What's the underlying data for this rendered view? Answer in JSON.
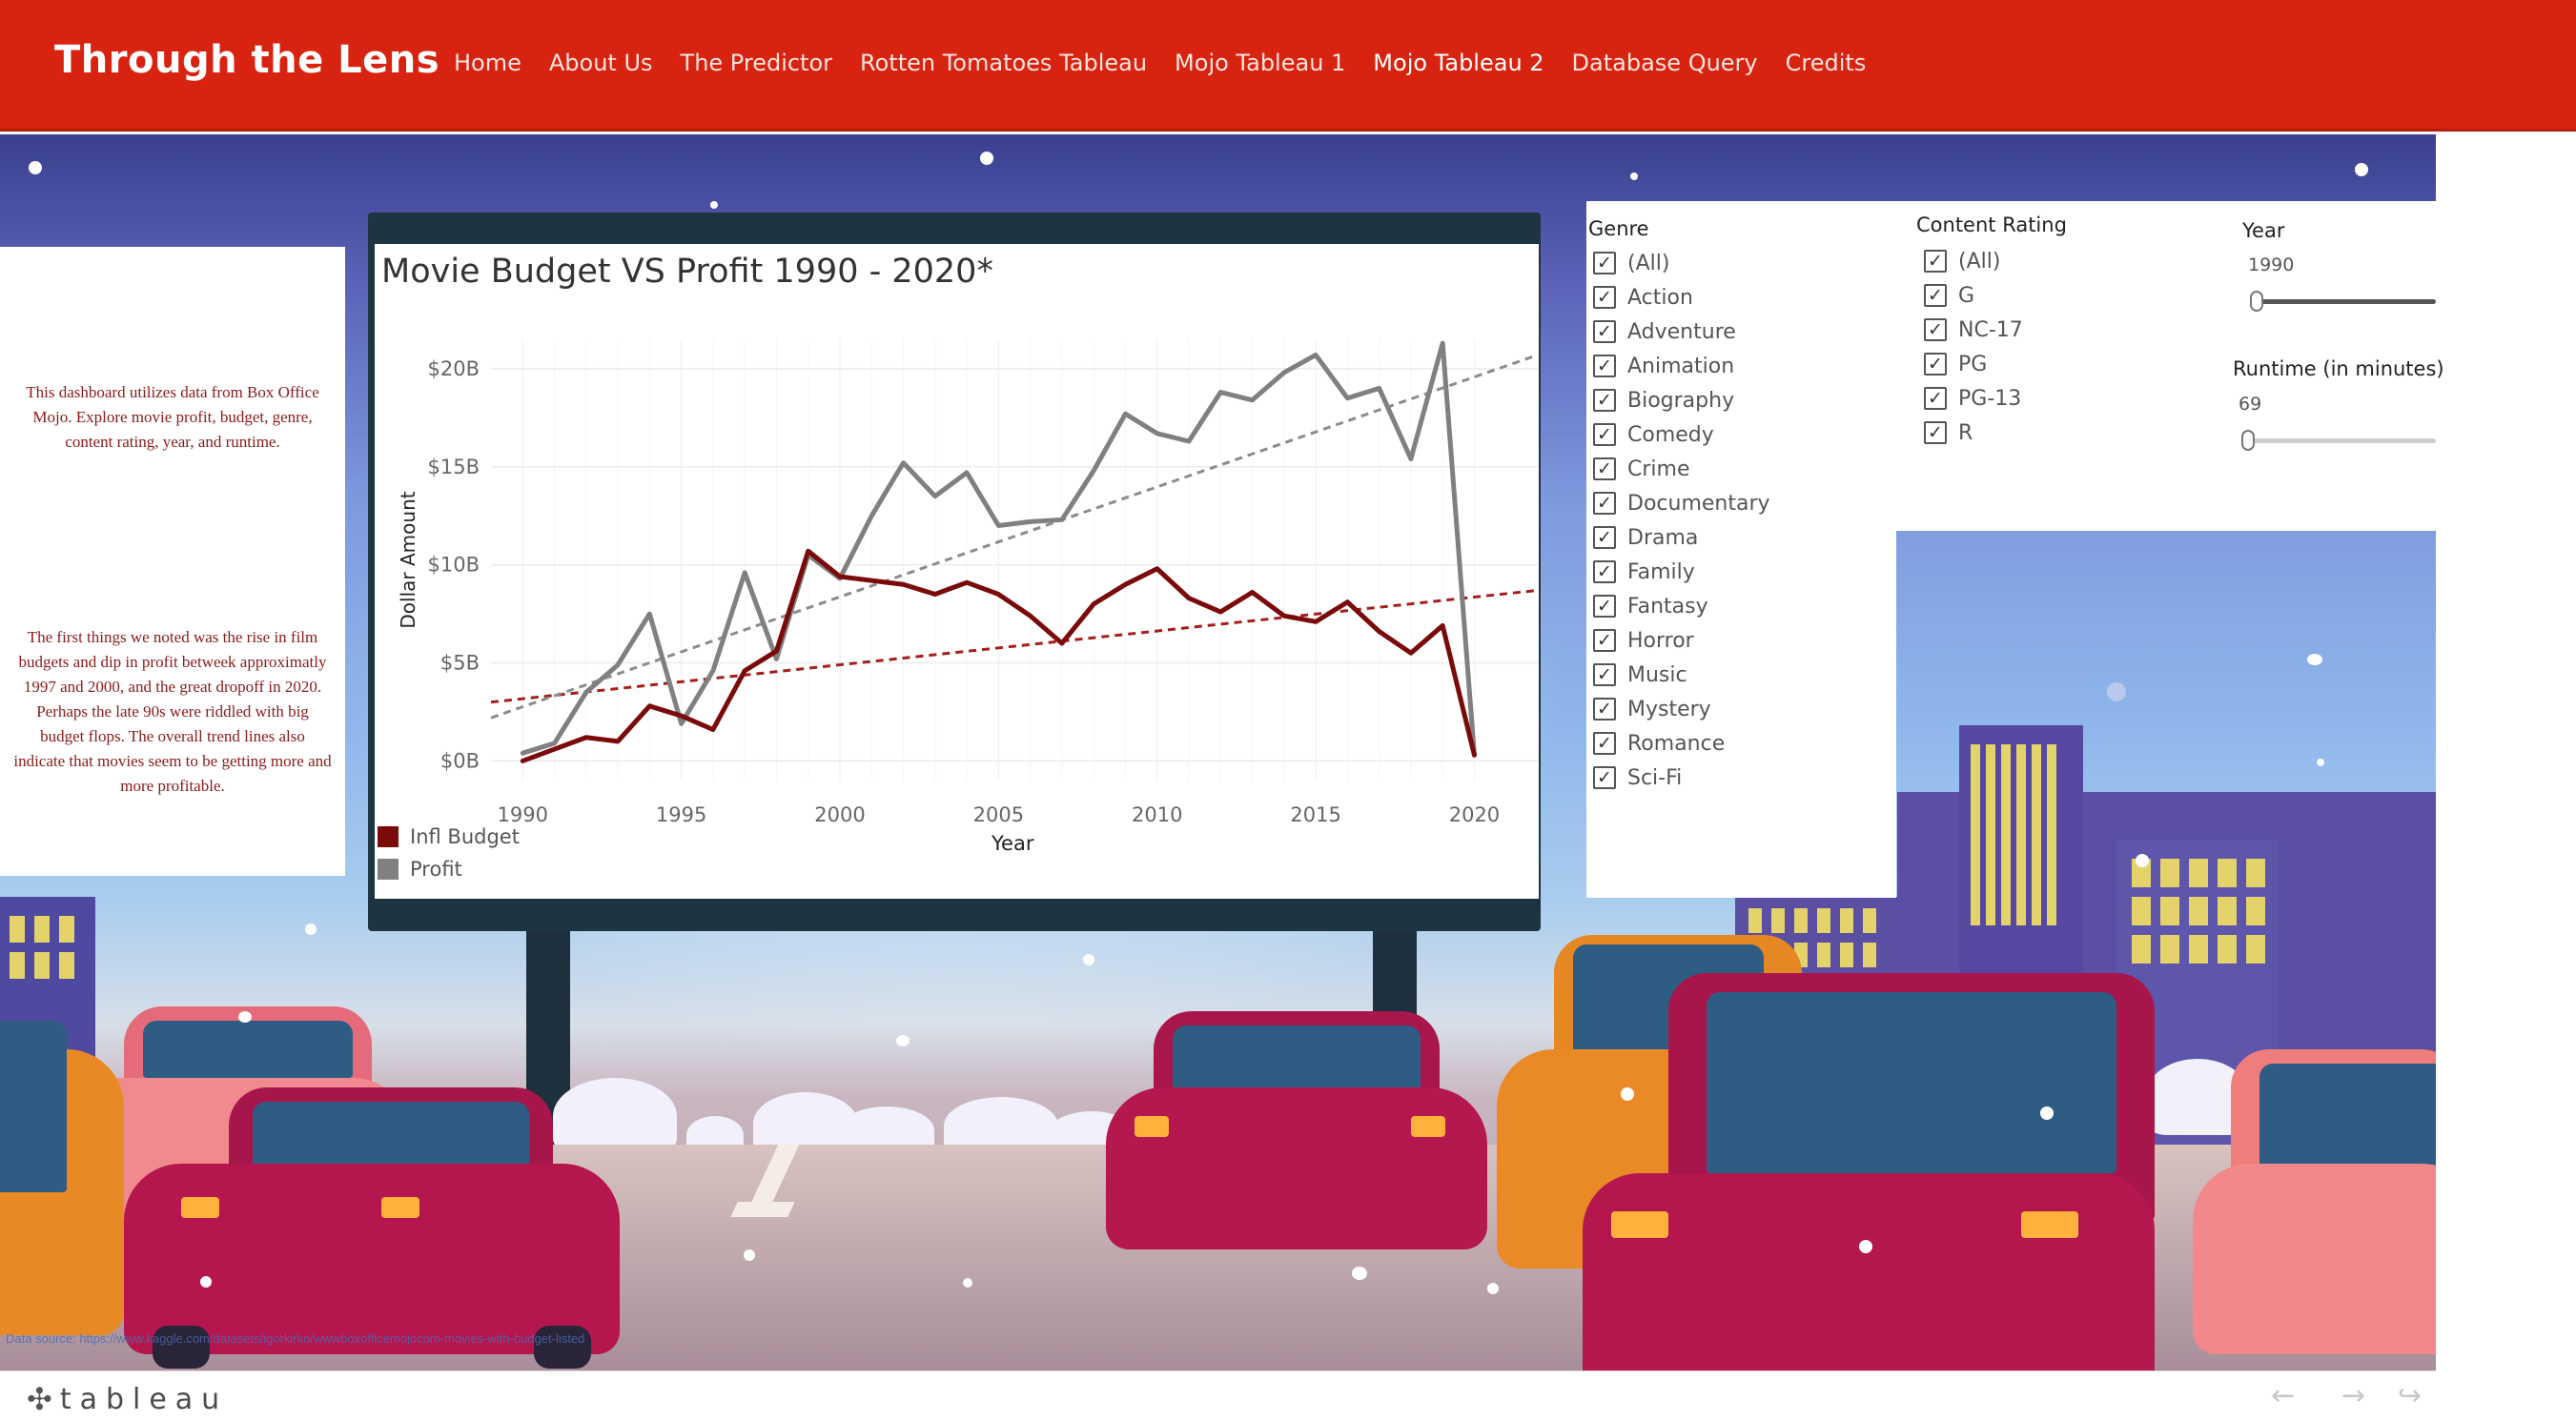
{
  "navbar": {
    "brand": "Through the Lens",
    "links": [
      {
        "label": "Home",
        "active": false
      },
      {
        "label": "About Us",
        "active": false
      },
      {
        "label": "The Predictor",
        "active": false
      },
      {
        "label": "Rotten Tomatoes Tableau",
        "active": false
      },
      {
        "label": "Mojo Tableau 1",
        "active": false
      },
      {
        "label": "Mojo Tableau 2",
        "active": true
      },
      {
        "label": "Database Query",
        "active": false
      },
      {
        "label": "Credits",
        "active": false
      }
    ],
    "bg_color": "#d7230f"
  },
  "description": {
    "paragraph1": "This dashboard utilizes data from Box Office Mojo. Explore movie profit, budget, genre, content rating, year, and runtime.",
    "paragraph2": "The first things we noted was the rise in film budgets and dip in profit betweek approximatly 1997 and 2000, and the great dropoff in 2020. Perhaps the late 90s were riddled with big budget flops. The overall trend lines also indicate that movies seem to be getting more and more profitable."
  },
  "chart_data": {
    "type": "line",
    "title": "Movie Budget VS Profit 1990 - 2020*",
    "xlabel": "Year",
    "ylabel": "Dollar Amount",
    "x": [
      1990,
      1991,
      1992,
      1993,
      1994,
      1995,
      1996,
      1997,
      1998,
      1999,
      2000,
      2001,
      2002,
      2003,
      2004,
      2005,
      2006,
      2007,
      2008,
      2009,
      2010,
      2011,
      2012,
      2013,
      2014,
      2015,
      2016,
      2017,
      2018,
      2019,
      2020
    ],
    "xlim": [
      1989,
      2022
    ],
    "ylim": [
      -1,
      21.5
    ],
    "x_ticks": [
      "1990",
      "1995",
      "2000",
      "2005",
      "2010",
      "2015",
      "2020"
    ],
    "y_ticks": [
      {
        "value": 0,
        "label": "$0B"
      },
      {
        "value": 5,
        "label": "$5B"
      },
      {
        "value": 10,
        "label": "$10B"
      },
      {
        "value": 15,
        "label": "$15B"
      },
      {
        "value": 20,
        "label": "$20B"
      }
    ],
    "series": [
      {
        "name": "Infl Budget",
        "color": "#7b0a0a",
        "values": [
          0.0,
          0.6,
          1.2,
          1.0,
          2.8,
          2.3,
          1.6,
          4.6,
          5.6,
          10.7,
          9.4,
          9.2,
          9.0,
          8.5,
          9.1,
          8.5,
          7.4,
          6.0,
          8.0,
          9.0,
          9.8,
          8.3,
          7.6,
          8.6,
          7.4,
          7.1,
          8.1,
          6.6,
          5.5,
          6.9,
          0.3
        ]
      },
      {
        "name": "Profit",
        "color": "#808080",
        "values": [
          0.4,
          0.9,
          3.5,
          4.9,
          7.5,
          1.9,
          4.6,
          9.6,
          5.2,
          10.5,
          9.3,
          12.5,
          15.2,
          13.5,
          14.7,
          12.0,
          12.2,
          12.3,
          14.8,
          17.7,
          16.7,
          16.3,
          18.8,
          18.4,
          19.8,
          20.7,
          18.5,
          19.0,
          15.4,
          21.3,
          0.3
        ]
      }
    ],
    "trend_lines": [
      {
        "series": "Infl Budget",
        "color": "#a61d1d",
        "from": [
          1989,
          3.0
        ],
        "to": [
          2022,
          8.7
        ]
      },
      {
        "series": "Profit",
        "color": "#8c8c8c",
        "from": [
          1989,
          2.2
        ],
        "to": [
          2022,
          20.7
        ]
      }
    ],
    "legend_position": "bottom-left",
    "grid": true
  },
  "filters": {
    "genre": {
      "heading": "Genre",
      "options": [
        "(All)",
        "Action",
        "Adventure",
        "Animation",
        "Biography",
        "Comedy",
        "Crime",
        "Documentary",
        "Drama",
        "Family",
        "Fantasy",
        "Horror",
        "Music",
        "Mystery",
        "Romance",
        "Sci-Fi"
      ],
      "all_checked": true
    },
    "content_rating": {
      "heading": "Content Rating",
      "options": [
        "(All)",
        "G",
        "NC-17",
        "PG",
        "PG-13",
        "R"
      ],
      "all_checked": true
    },
    "year": {
      "heading": "Year",
      "value": "1990"
    },
    "runtime": {
      "heading": "Runtime (in minutes)",
      "value": "69"
    }
  },
  "data_source": "Data source: https://www.kaggle.com/datasets/igorkirko/wwwboxofficemojocom-movies-with-budget-listed",
  "footer": {
    "logo_text": "tableau",
    "logo_icon": "tableau-cross-icon",
    "nav_icons": [
      "undo-arrow-icon",
      "redo-arrow-icon",
      "share-icon"
    ]
  }
}
